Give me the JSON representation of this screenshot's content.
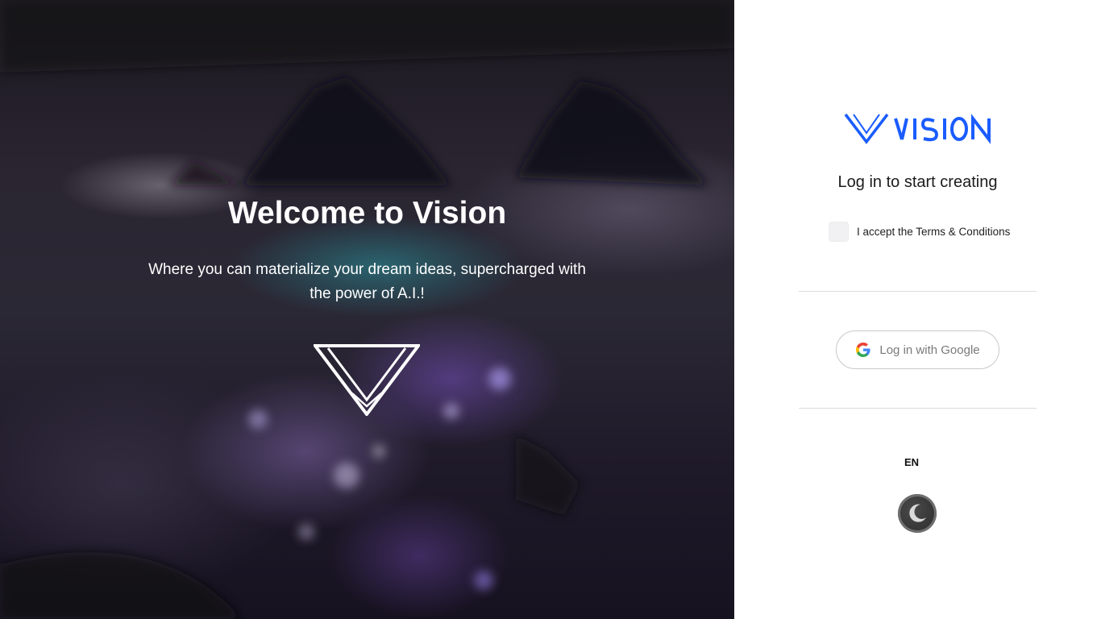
{
  "hero": {
    "title": "Welcome to Vision",
    "subtitle": "Where you can materialize your dream ideas, supercharged with the power of A.I.!"
  },
  "panel": {
    "logo_text": "VISION",
    "heading": "Log in to start creating",
    "terms_label": "I accept the Terms & Conditions",
    "terms_checked": false,
    "google_button_label": "Log in with Google",
    "language": "EN",
    "theme_icon": "moon-icon"
  },
  "colors": {
    "brand_blue": "#1a5cff",
    "button_border": "#c9c9c9",
    "toggle_bg": "#2e2e2e"
  }
}
